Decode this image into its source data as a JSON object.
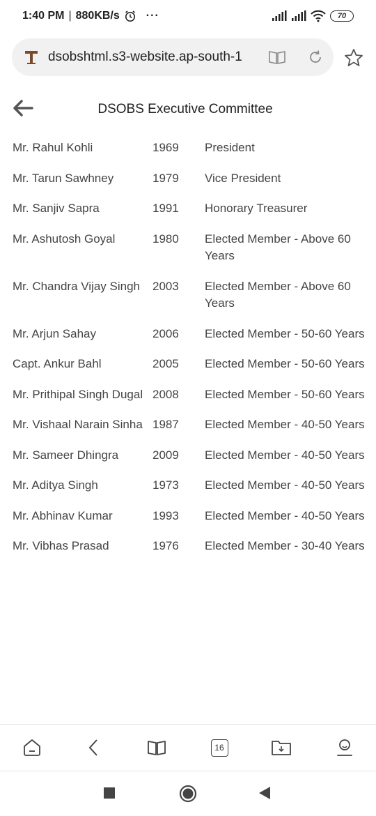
{
  "status_bar": {
    "time": "1:40 PM",
    "separator": "|",
    "speed": "880KB/s",
    "more": "···",
    "battery": "70"
  },
  "browser": {
    "url": "dsobshtml.s3-website.ap-south-1",
    "tabs_count": "16"
  },
  "page": {
    "title": "DSOBS Executive Committee",
    "members": [
      {
        "name": "Mr. Rahul Kohli",
        "year": "1969",
        "role": "President"
      },
      {
        "name": "Mr. Tarun Sawhney",
        "year": "1979",
        "role": "Vice President"
      },
      {
        "name": "Mr. Sanjiv Sapra",
        "year": "1991",
        "role": "Honorary Treasurer"
      },
      {
        "name": "Mr. Ashutosh Goyal",
        "year": "1980",
        "role": "Elected Member - Above 60 Years"
      },
      {
        "name": "Mr. Chandra Vijay Singh",
        "year": "2003",
        "role": "Elected Member - Above 60 Years"
      },
      {
        "name": "Mr. Arjun Sahay",
        "year": "2006",
        "role": "Elected Member - 50-60 Years"
      },
      {
        "name": "Capt. Ankur Bahl",
        "year": "2005",
        "role": "Elected Member - 50-60 Years"
      },
      {
        "name": "Mr. Prithipal Singh Dugal",
        "year": "2008",
        "role": "Elected Member - 50-60 Years"
      },
      {
        "name": "Mr. Vishaal Narain Sinha",
        "year": "1987",
        "role": "Elected Member - 40-50 Years"
      },
      {
        "name": "Mr. Sameer Dhingra",
        "year": "2009",
        "role": "Elected Member - 40-50 Years"
      },
      {
        "name": "Mr. Aditya Singh",
        "year": "1973",
        "role": "Elected Member - 40-50 Years"
      },
      {
        "name": "Mr. Abhinav Kumar",
        "year": "1993",
        "role": "Elected Member - 40-50 Years"
      },
      {
        "name": "Mr. Vibhas Prasad",
        "year": "1976",
        "role": "Elected Member - 30-40 Years"
      }
    ]
  },
  "icons": {
    "status": [
      "alarm-icon",
      "signal-icon",
      "wifi-icon",
      "battery-icon"
    ],
    "url_bar": [
      "site-favicon",
      "reader-mode-icon",
      "reload-icon"
    ],
    "toolbar": [
      "home-icon",
      "back-icon",
      "bookmarks-icon",
      "tabs-icon",
      "downloads-icon",
      "profile-icon"
    ],
    "navbar": [
      "recents-icon",
      "home-circle-icon",
      "nav-back-icon"
    ]
  }
}
